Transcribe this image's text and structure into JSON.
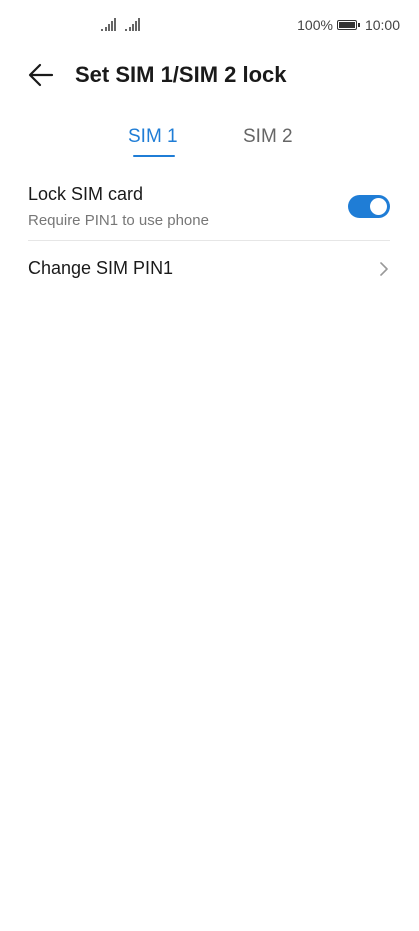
{
  "status_bar": {
    "battery_percent": "100%",
    "time": "10:00",
    "sim_signals": [
      "signal-icon",
      "signal-icon"
    ]
  },
  "header": {
    "title": "Set SIM 1/SIM 2 lock",
    "back_icon": "back-arrow-icon"
  },
  "tabs": [
    {
      "label": "SIM 1",
      "active": true
    },
    {
      "label": "SIM 2",
      "active": false
    }
  ],
  "settings": {
    "lock_sim": {
      "title": "Lock SIM card",
      "subtitle": "Require PIN1 to use phone",
      "enabled": true
    },
    "change_pin": {
      "title": "Change SIM PIN1"
    }
  },
  "colors": {
    "accent": "#1f7dd6",
    "text_primary": "#1a1a1a",
    "text_secondary": "#777777",
    "divider": "#e6e6e6"
  }
}
